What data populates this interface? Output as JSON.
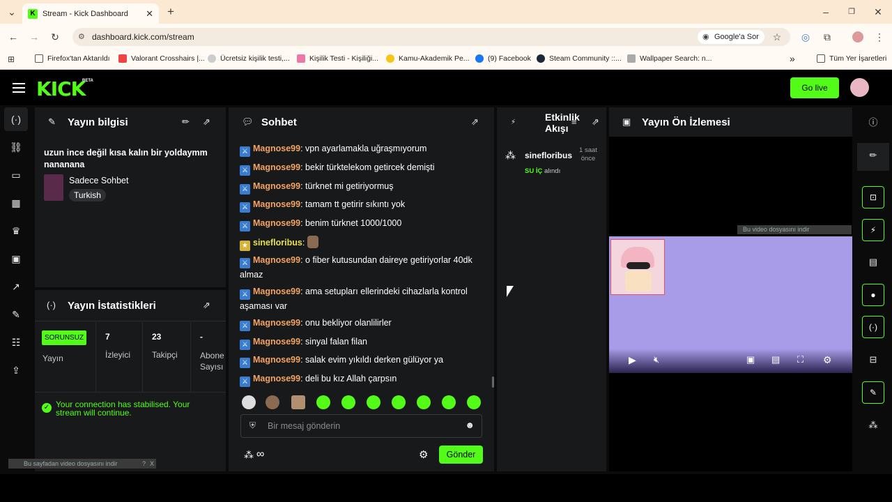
{
  "browser": {
    "tab_title": "Stream - Kick Dashboard",
    "url": "dashboard.kick.com/stream",
    "google_sor": "Google'a Sor",
    "bookmarks": [
      "Firefox'tan Aktarıldı",
      "Valorant Crosshairs |...",
      "Ücretsiz kişilik testi,...",
      "Kişilik Testi - Kişiliği...",
      "Kamu-Akademik Pe...",
      "(9) Facebook",
      "Steam Community ::...",
      "Wallpaper Search: n...",
      "Tüm Yer İşaretleri"
    ],
    "more": "»"
  },
  "topbar": {
    "logo": "KICK",
    "beta": "BETA",
    "go_live": "Go live"
  },
  "stream_info": {
    "title": "Yayın bilgisi",
    "stream_title": "uzun ince değil kısa kalın bir yoldaymm nananana",
    "category": "Sadece Sohbet",
    "tag": "Turkish"
  },
  "stream_stats": {
    "title": "Yayın İstatistikleri",
    "status_badge": "SORUNSUZ",
    "status_label": "Yayın",
    "viewers_value": "7",
    "viewers_label": "İzleyici",
    "followers_value": "23",
    "followers_label": "Takipçi",
    "subs_value": "-",
    "subs_label": "Abone Sayısı",
    "connection_msg": "Your connection has stabilised. Your stream will continue."
  },
  "chat": {
    "title": "Sohbet",
    "messages": [
      {
        "user": "Magnose99",
        "text": ": vpn ayarlamakla uğraşmıyorum"
      },
      {
        "user": "Magnose99",
        "text": ": bekir türktelekom getircek demişti"
      },
      {
        "user": "Magnose99",
        "text": ": türknet mi getiriyormuş"
      },
      {
        "user": "Magnose99",
        "text": ": tamam tt getirir sıkıntı yok"
      },
      {
        "user": "Magnose99",
        "text": ": benim türknet 1000/1000"
      },
      {
        "user": "sinefloribus",
        "text": ":"
      },
      {
        "user": "Magnose99",
        "text": ": o fiber kutusundan daireye getiriyorlar 40dk almaz"
      },
      {
        "user": "Magnose99",
        "text": ": ama setupları ellerindeki cihazlarla kontrol aşaması var"
      },
      {
        "user": "Magnose99",
        "text": ": onu bekliyor olanlilirler"
      },
      {
        "user": "Magnose99",
        "text": ": sinyal falan filan"
      },
      {
        "user": "Magnose99",
        "text": ": salak evim yıkıldı derken gülüyor ya"
      },
      {
        "user": "Magnose99",
        "text": ": deli bu kız Allah çarpsın"
      }
    ],
    "input_placeholder": "Bir mesaj gönderin",
    "send_label": "Gönder",
    "infinity": "∞"
  },
  "activity": {
    "title": "Etkinlik Akışı",
    "user": "sinefloribus",
    "time": "1 saat önce",
    "item": "SU İÇ",
    "item_suffix": "alındı"
  },
  "preview": {
    "title": "Yayın Ön İzlemesi"
  },
  "overlay": {
    "download_video": "Bu video dosyasını indir",
    "download_page": "Bu sayfadan video dosyasını indir",
    "help": "?",
    "close": "X"
  },
  "colors": {
    "accent": "#53fc18",
    "panel": "#18191b",
    "username": "#f4a460"
  }
}
